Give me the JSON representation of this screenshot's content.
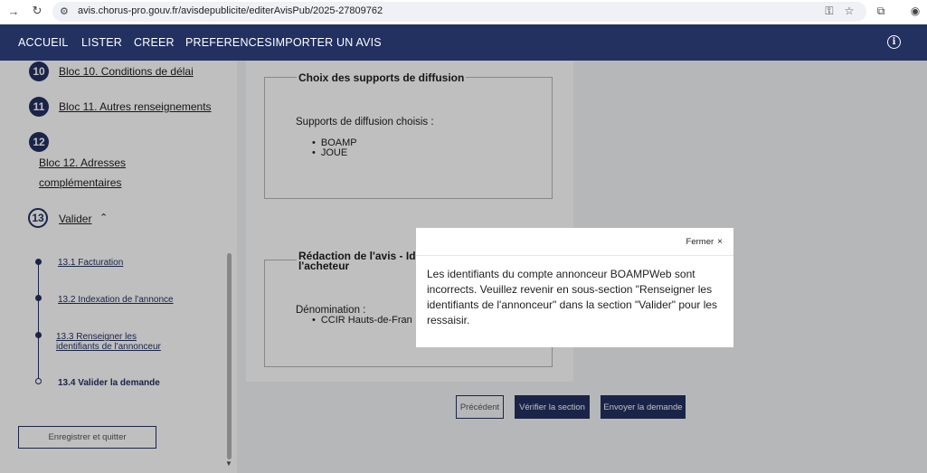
{
  "browser": {
    "url": "avis.chorus-pro.gouv.fr/avisdepublicite/editerAvisPub/2025-27809762"
  },
  "nav": {
    "items": [
      "ACCUEIL",
      "LISTER",
      "CREER",
      "PREFERENCES",
      "IMPORTER UN AVIS"
    ]
  },
  "sidebar": {
    "steps": [
      {
        "number": "10",
        "label": "Bloc 10. Conditions de délai"
      },
      {
        "number": "11",
        "label": "Bloc 11. Autres renseignements"
      },
      {
        "number": "12",
        "label_line1": "Bloc 12. Adresses",
        "label_line2": "complémentaires"
      },
      {
        "number": "13",
        "label": "Valider"
      }
    ],
    "substeps": [
      {
        "label": "13.1 Facturation"
      },
      {
        "label": "13.2 Indexation de l'annonce"
      },
      {
        "label_line1": "13.3 Renseigner les",
        "label_line2": "identifiants de l'annonceur"
      },
      {
        "label": "13.4 Valider la demande"
      }
    ],
    "save_label": "Enregistrer et quitter"
  },
  "main": {
    "supports": {
      "legend": "Choix des supports de diffusion",
      "intro": "Supports de diffusion choisis :",
      "items": [
        "BOAMP",
        "JOUE"
      ]
    },
    "redaction": {
      "legend_line1": "Rédaction de l'avis - Ide",
      "legend_line2": "l'acheteur",
      "field_label": "Dénomination :",
      "field_value": "CCIR Hauts-de-Fran"
    },
    "buttons": {
      "previous": "Précédent",
      "verify": "Vérifier la section",
      "send": "Envoyer la demande"
    }
  },
  "modal": {
    "close_label": "Fermer",
    "message": "Les identifiants du compte annonceur BOAMPWeb sont incorrects. Veuillez revenir en sous-section \"Renseigner les identifiants de l'annonceur\" dans la section \"Valider\" pour les ressaisir."
  }
}
